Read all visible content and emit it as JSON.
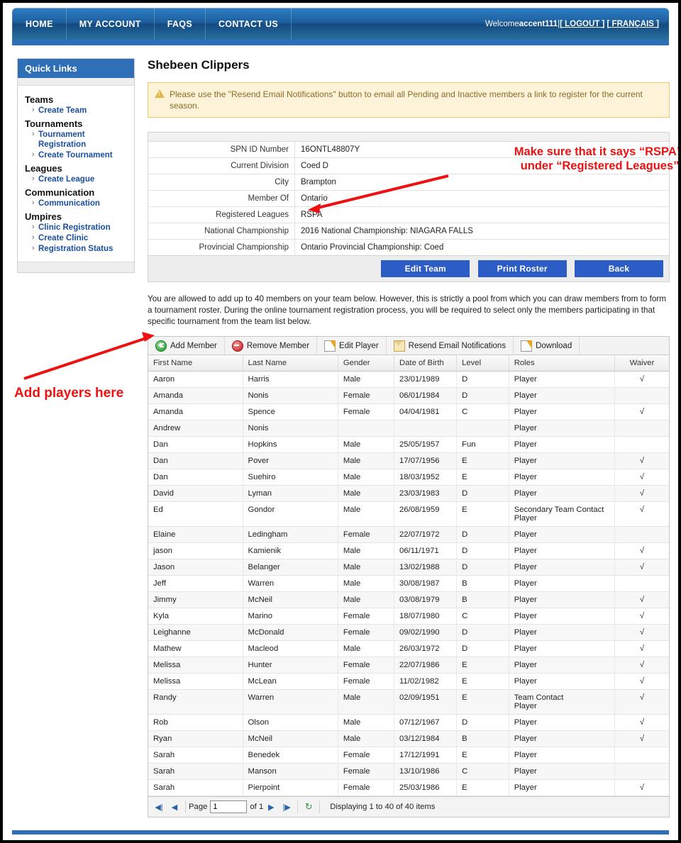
{
  "nav": {
    "items": [
      {
        "label": "HOME",
        "name": "nav-home"
      },
      {
        "label": "MY ACCOUNT",
        "name": "nav-my-account"
      },
      {
        "label": "FAQS",
        "name": "nav-faqs"
      },
      {
        "label": "CONTACT US",
        "name": "nav-contact-us"
      }
    ],
    "welcome_prefix": "Welcome ",
    "username": "accent111",
    "welcome_suffix": "| ",
    "logout": "[ LOGOUT ]",
    "francais": "[ FRANÇAIS ]"
  },
  "sidebar": {
    "title": "Quick Links",
    "groups": [
      {
        "heading": "Teams",
        "links": [
          "Create Team"
        ]
      },
      {
        "heading": "Tournaments",
        "links": [
          "Tournament Registration",
          "Create Tournament"
        ]
      },
      {
        "heading": "Leagues",
        "links": [
          "Create League"
        ]
      },
      {
        "heading": "Communication",
        "links": [
          "Communication"
        ]
      },
      {
        "heading": "Umpires",
        "links": [
          "Clinic Registration",
          "Create Clinic",
          "Registration Status"
        ]
      }
    ]
  },
  "main": {
    "page_title": "Shebeen Clippers",
    "notice": "Please use the \"Resend Email Notifications\" button to email all Pending and Inactive members a link to register for the current season.",
    "info_rows": [
      {
        "label": "SPN ID Number",
        "value": "16ONTL48807Y"
      },
      {
        "label": "Current Division",
        "value": "Coed D"
      },
      {
        "label": "City",
        "value": "Brampton"
      },
      {
        "label": "Member Of",
        "value": "Ontario"
      },
      {
        "label": "Registered Leagues",
        "value": "RSPA"
      },
      {
        "label": "National Championship",
        "value": "2016 National Championship: NIAGARA FALLS"
      },
      {
        "label": "Provincial Championship",
        "value": "Ontario Provincial Championship: Coed"
      }
    ],
    "buttons": [
      {
        "label": "Edit Team",
        "name": "edit-team-button"
      },
      {
        "label": "Print Roster",
        "name": "print-roster-button"
      },
      {
        "label": "Back",
        "name": "back-button"
      }
    ],
    "description": "You are allowed to add up to 40 members on your team below. However, this is strictly a pool from which you can draw members from to form a tournament roster. During the online tournament registration process, you will be required to select only the members participating in that specific tournament from the team list below."
  },
  "toolbar": {
    "buttons": [
      {
        "label": "Add Member",
        "icon": "plus-icon",
        "name": "add-member-button"
      },
      {
        "label": "Remove Member",
        "icon": "minus-icon",
        "name": "remove-member-button"
      },
      {
        "label": "Edit Player",
        "icon": "pencil-icon",
        "name": "edit-player-button"
      },
      {
        "label": "Resend Email Notifications",
        "icon": "envelope-icon",
        "name": "resend-email-notifications-button"
      },
      {
        "label": "Download",
        "icon": "pencil-icon",
        "name": "download-button"
      }
    ]
  },
  "grid": {
    "columns": [
      "First Name",
      "Last Name",
      "Gender",
      "Date of Birth",
      "Level",
      "Roles",
      "Waiver"
    ],
    "rows": [
      {
        "first": "Aaron",
        "last": "Harris",
        "gender": "Male",
        "dob": "23/01/1989",
        "level": "D",
        "roles": "Player",
        "waiver": "√"
      },
      {
        "first": "Amanda",
        "last": "Nonis",
        "gender": "Female",
        "dob": "06/01/1984",
        "level": "D",
        "roles": "Player",
        "waiver": ""
      },
      {
        "first": "Amanda",
        "last": "Spence",
        "gender": "Female",
        "dob": "04/04/1981",
        "level": "C",
        "roles": "Player",
        "waiver": "√"
      },
      {
        "first": "Andrew",
        "last": "Nonis",
        "gender": "",
        "dob": "",
        "level": "",
        "roles": "Player",
        "waiver": ""
      },
      {
        "first": "Dan",
        "last": "Hopkins",
        "gender": "Male",
        "dob": "25/05/1957",
        "level": "Fun",
        "roles": "Player",
        "waiver": ""
      },
      {
        "first": "Dan",
        "last": "Pover",
        "gender": "Male",
        "dob": "17/07/1956",
        "level": "E",
        "roles": "Player",
        "waiver": "√"
      },
      {
        "first": "Dan",
        "last": "Suehiro",
        "gender": "Male",
        "dob": "18/03/1952",
        "level": "E",
        "roles": "Player",
        "waiver": "√"
      },
      {
        "first": "David",
        "last": "Lyman",
        "gender": "Male",
        "dob": "23/03/1983",
        "level": "D",
        "roles": "Player",
        "waiver": "√"
      },
      {
        "first": "Ed",
        "last": "Gondor",
        "gender": "Male",
        "dob": "26/08/1959",
        "level": "E",
        "roles": "Secondary Team Contact\nPlayer",
        "waiver": "√"
      },
      {
        "first": "Elaine",
        "last": "Ledingham",
        "gender": "Female",
        "dob": "22/07/1972",
        "level": "D",
        "roles": "Player",
        "waiver": ""
      },
      {
        "first": "jason",
        "last": "Kamienik",
        "gender": "Male",
        "dob": "06/11/1971",
        "level": "D",
        "roles": "Player",
        "waiver": "√"
      },
      {
        "first": "Jason",
        "last": "Belanger",
        "gender": "Male",
        "dob": "13/02/1988",
        "level": "D",
        "roles": "Player",
        "waiver": "√"
      },
      {
        "first": "Jeff",
        "last": "Warren",
        "gender": "Male",
        "dob": "30/08/1987",
        "level": "B",
        "roles": "Player",
        "waiver": ""
      },
      {
        "first": "Jimmy",
        "last": "McNeil",
        "gender": "Male",
        "dob": "03/08/1979",
        "level": "B",
        "roles": "Player",
        "waiver": "√"
      },
      {
        "first": "Kyla",
        "last": "Marino",
        "gender": "Female",
        "dob": "18/07/1980",
        "level": "C",
        "roles": "Player",
        "waiver": "√"
      },
      {
        "first": "Leighanne",
        "last": "McDonald",
        "gender": "Female",
        "dob": "09/02/1990",
        "level": "D",
        "roles": "Player",
        "waiver": "√"
      },
      {
        "first": "Mathew",
        "last": "Macleod",
        "gender": "Male",
        "dob": "26/03/1972",
        "level": "D",
        "roles": "Player",
        "waiver": "√"
      },
      {
        "first": "Melissa",
        "last": "Hunter",
        "gender": "Female",
        "dob": "22/07/1986",
        "level": "E",
        "roles": "Player",
        "waiver": "√"
      },
      {
        "first": "Melissa",
        "last": "McLean",
        "gender": "Female",
        "dob": "11/02/1982",
        "level": "E",
        "roles": "Player",
        "waiver": "√"
      },
      {
        "first": "Randy",
        "last": "Warren",
        "gender": "Male",
        "dob": "02/09/1951",
        "level": "E",
        "roles": "Team Contact\nPlayer",
        "waiver": "√"
      },
      {
        "first": "Rob",
        "last": "Olson",
        "gender": "Male",
        "dob": "07/12/1967",
        "level": "D",
        "roles": "Player",
        "waiver": "√"
      },
      {
        "first": "Ryan",
        "last": "McNeil",
        "gender": "Male",
        "dob": "03/12/1984",
        "level": "B",
        "roles": "Player",
        "waiver": "√"
      },
      {
        "first": "Sarah",
        "last": "Benedek",
        "gender": "Female",
        "dob": "17/12/1991",
        "level": "E",
        "roles": "Player",
        "waiver": ""
      },
      {
        "first": "Sarah",
        "last": "Manson",
        "gender": "Female",
        "dob": "13/10/1986",
        "level": "C",
        "roles": "Player",
        "waiver": ""
      },
      {
        "first": "Sarah",
        "last": "Pierpoint",
        "gender": "Female",
        "dob": "25/03/1986",
        "level": "E",
        "roles": "Player",
        "waiver": "√"
      }
    ]
  },
  "pager": {
    "first_icon": "◀|",
    "prev_icon": "◀",
    "next_icon": "▶",
    "last_icon": "|▶",
    "refresh_icon": "↻",
    "page_label": "Page",
    "page_value": "1",
    "of_label": "of 1",
    "display_info": "Displaying 1 to 40 of 40 items"
  },
  "annotations": {
    "rspa_line1": "Make sure that it says “RSPA”",
    "rspa_line2": "under “Registered Leagues”.",
    "add_players": "Add players here",
    "color": "#ee1111"
  }
}
